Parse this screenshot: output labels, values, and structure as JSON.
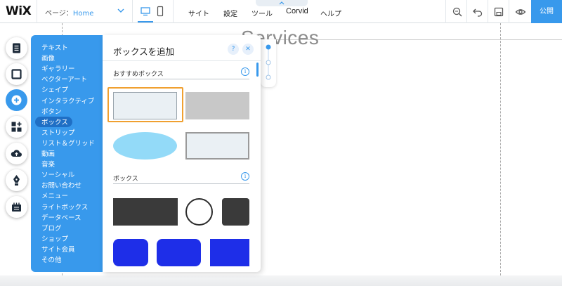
{
  "topbar": {
    "logo": "WiX",
    "page_label": "ページ：",
    "page_value": "Home",
    "menu": [
      "サイト",
      "設定",
      "ツール",
      "Corvid",
      "ヘルプ"
    ],
    "publish": "公開"
  },
  "canvas": {
    "heading": "Services"
  },
  "panel": {
    "title": "ボックスを追加",
    "help": "?",
    "close": "✕",
    "nav": [
      "テキスト",
      "画像",
      "ギャラリー",
      "ベクターアート",
      "シェイプ",
      "インタラクティブ",
      "ボタン",
      "ボックス",
      "ストリップ",
      "リスト＆グリッド",
      "動画",
      "音楽",
      "ソーシャル",
      "お問い合わせ",
      "メニュー",
      "ライトボックス",
      "データベース",
      "ブログ",
      "ショップ",
      "サイト会員",
      "その他"
    ],
    "selected_nav": "ボックス",
    "sections": [
      {
        "title": "おすすめボックス",
        "info": "i"
      },
      {
        "title": "ボックス",
        "info": "i"
      }
    ]
  },
  "colors": {
    "accent": "#3899ec",
    "nav_selected": "#1f6fc5",
    "highlight_border": "#f0a030",
    "dark_box": "#3a3a3a",
    "blue_box": "#1e2ee8",
    "ellipse": "#93daf8"
  },
  "icons": {
    "sidebar": [
      "pages-icon",
      "background-icon",
      "add-icon",
      "apps-icon",
      "upload-icon",
      "pen-icon",
      "market-icon"
    ],
    "toolbar": [
      "zoom-icon",
      "undo-icon",
      "save-icon",
      "preview-icon"
    ]
  }
}
